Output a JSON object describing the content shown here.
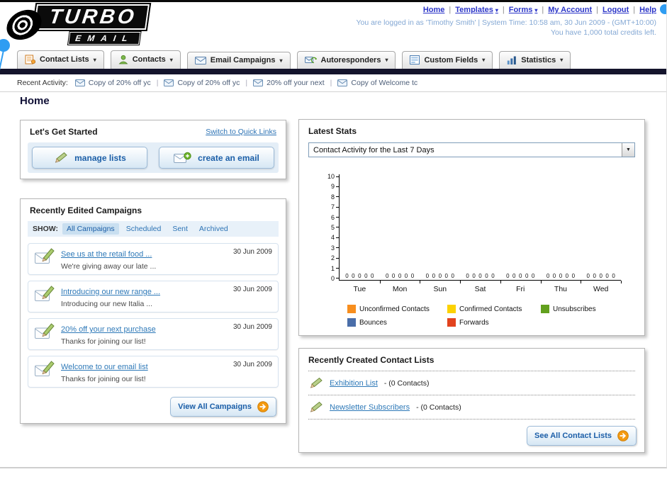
{
  "header": {
    "logo_title": "TURBO",
    "logo_subtitle": "EMAIL",
    "nav_links": [
      {
        "label": "Home",
        "dropdown": false
      },
      {
        "label": "Templates",
        "dropdown": true
      },
      {
        "label": "Forms",
        "dropdown": true
      },
      {
        "label": "My Account",
        "dropdown": false
      },
      {
        "label": "Logout",
        "dropdown": false
      },
      {
        "label": "Help",
        "dropdown": false
      }
    ],
    "status_line1": "You are logged in as 'Timothy Smith' | System Time: 10:58 am, 30 Jun 2009 - (GMT+10:00)",
    "status_line2": "You have 1,000 total credits left."
  },
  "main_nav": [
    {
      "label": "Contact Lists",
      "icon": "contact-lists-icon"
    },
    {
      "label": "Contacts",
      "icon": "contacts-icon"
    },
    {
      "label": "Email Campaigns",
      "icon": "email-campaigns-icon"
    },
    {
      "label": "Autoresponders",
      "icon": "autoresponders-icon"
    },
    {
      "label": "Custom Fields",
      "icon": "custom-fields-icon"
    },
    {
      "label": "Statistics",
      "icon": "statistics-icon"
    }
  ],
  "recent_activity": {
    "label": "Recent Activity:",
    "items": [
      "Copy of 20% off yc",
      "Copy of 20% off yc",
      "20% off your next",
      "Copy of Welcome tc"
    ]
  },
  "page_title": "Home",
  "get_started": {
    "title": "Let's Get Started",
    "switch_link": "Switch to Quick Links",
    "buttons": [
      {
        "label": "manage lists",
        "icon": "pencil-icon"
      },
      {
        "label": "create an email",
        "icon": "envelope-plus-icon"
      }
    ]
  },
  "campaigns": {
    "title": "Recently Edited Campaigns",
    "show_label": "SHOW:",
    "tabs": [
      "All Campaigns",
      "Scheduled",
      "Sent",
      "Archived"
    ],
    "active_tab": "All Campaigns",
    "rows": [
      {
        "title": "See us at the retail food ...",
        "subtitle": "We're giving away our late ...",
        "date": "30 Jun 2009"
      },
      {
        "title": "Introducing our new range ...",
        "subtitle": "Introducing our new Italia ...",
        "date": "30 Jun 2009"
      },
      {
        "title": "20% off your next purchase",
        "subtitle": "Thanks for joining our list!",
        "date": "30 Jun 2009"
      },
      {
        "title": "Welcome to our email list",
        "subtitle": "Thanks for joining our list!",
        "date": "30 Jun 2009"
      }
    ],
    "view_all_label": "View All Campaigns"
  },
  "latest_stats": {
    "title": "Latest Stats",
    "dropdown_value": "Contact Activity for the Last 7 Days"
  },
  "chart_data": {
    "type": "bar",
    "title": "Contact Activity for the Last 7 Days",
    "categories": [
      "Tue",
      "Mon",
      "Sun",
      "Sat",
      "Fri",
      "Thu",
      "Wed"
    ],
    "series": [
      {
        "name": "Unconfirmed Contacts",
        "color": "#F78E1E",
        "values": [
          0,
          0,
          0,
          0,
          0,
          0,
          0
        ]
      },
      {
        "name": "Confirmed Contacts",
        "color": "#FCD202",
        "values": [
          0,
          0,
          0,
          0,
          0,
          0,
          0
        ]
      },
      {
        "name": "Unsubscribes",
        "color": "#62A01E",
        "values": [
          0,
          0,
          0,
          0,
          0,
          0,
          0
        ]
      },
      {
        "name": "Bounces",
        "color": "#4A6EA9",
        "values": [
          0,
          0,
          0,
          0,
          0,
          0,
          0
        ]
      },
      {
        "name": "Forwards",
        "color": "#E2431E",
        "values": [
          0,
          0,
          0,
          0,
          0,
          0,
          0
        ]
      }
    ],
    "xlabel": "",
    "ylabel": "",
    "ylim": [
      0,
      10
    ],
    "yticks": [
      0,
      1,
      2,
      3,
      4,
      5,
      6,
      7,
      8,
      9,
      10
    ],
    "grid": false,
    "legend_position": "bottom"
  },
  "contact_lists": {
    "title": "Recently Created Contact Lists",
    "items": [
      {
        "name": "Exhibition List",
        "suffix": "- (0 Contacts)"
      },
      {
        "name": "Newsletter Subscribers",
        "suffix": "- (0 Contacts)"
      }
    ],
    "see_all_label": "See All Contact Lists"
  },
  "colors": {
    "accent_orange": "#F49A10",
    "link_blue": "#2E74B5",
    "top_link_blue": "#2B35C8",
    "nav_dark_bar": "#14142C",
    "status_text_blue": "#84A8D4"
  }
}
